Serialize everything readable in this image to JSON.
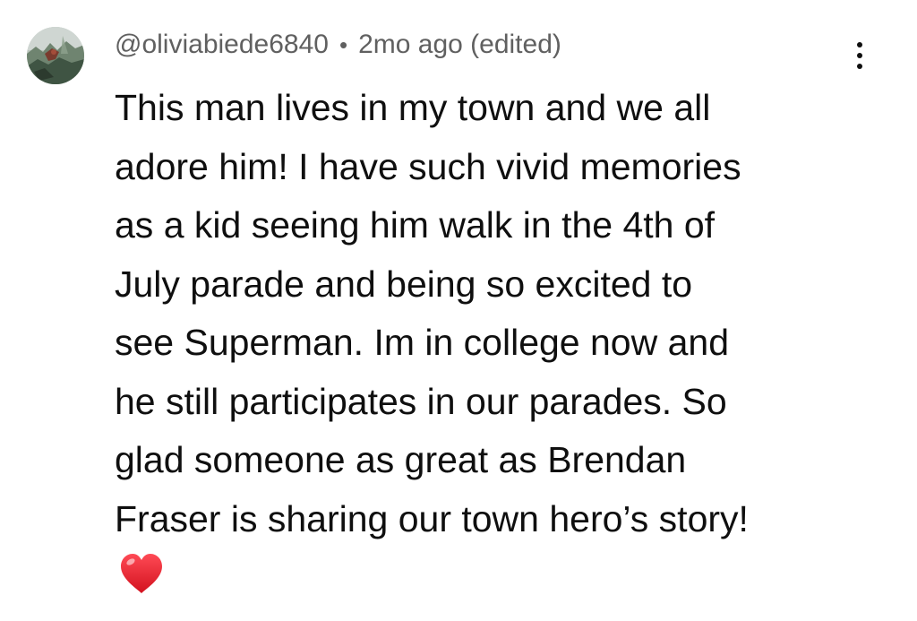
{
  "comment": {
    "author": "@oliviabiede6840",
    "separator": "•",
    "timestamp": "2mo ago (edited)",
    "lines": [
      "This man lives in my town and we all",
      "adore him! I have such vivid memories",
      "as a kid seeing him walk in the 4th of",
      "July parade and being so excited to",
      "see Superman. Im in college now and",
      "he still participates in our parades. So",
      "glad someone as great as Brendan",
      "Fraser is sharing our town hero’s story!"
    ],
    "emoji": "red-heart-icon"
  },
  "menu": {
    "icon": "more-vertical-icon"
  },
  "colors": {
    "background": "#ffffff",
    "text": "#0f0f0f",
    "meta": "#606060",
    "heart": "#e0162b"
  }
}
